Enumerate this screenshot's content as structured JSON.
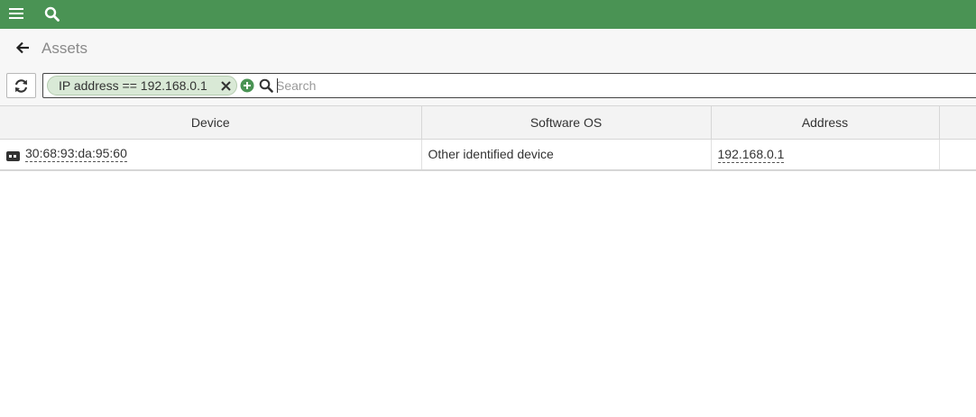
{
  "topbar": {
    "color": "#4a9354",
    "icons": [
      "menu-icon",
      "search-icon"
    ]
  },
  "page": {
    "title": "Assets"
  },
  "filter": {
    "chip_label": "IP address == 192.168.0.1",
    "search_placeholder": "Search"
  },
  "table": {
    "columns": [
      "Device",
      "Software OS",
      "Address",
      ""
    ],
    "rows": [
      {
        "device": "30:68:93:da:95:60",
        "os": "Other identified device",
        "address": "192.168.0.1"
      }
    ]
  }
}
